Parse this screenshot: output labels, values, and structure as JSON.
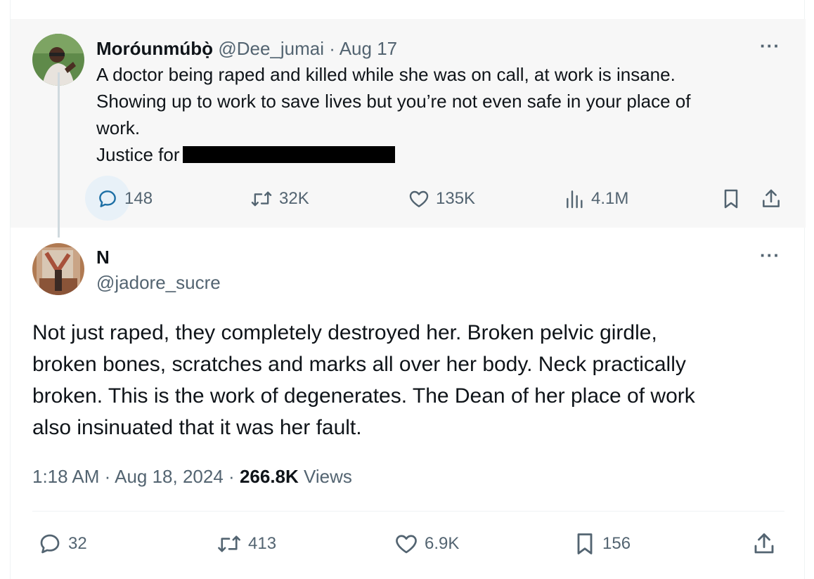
{
  "parent_tweet": {
    "display_name": "Moróunmúbọ̀",
    "handle": "@Dee_jumai",
    "separator": "·",
    "date": "Aug 17",
    "more_icon": "more-horizontal-icon",
    "lines": [
      "A doctor being raped and killed while she was on call, at work is insane.",
      "Showing up to work to save lives but you’re not even safe in your place of",
      "work.",
      "Justice for"
    ],
    "stats": {
      "replies": "148",
      "reposts": "32K",
      "likes": "135K",
      "views": "4.1M"
    }
  },
  "main_tweet": {
    "display_name": "N",
    "handle": "@jadore_sucre",
    "lines": [
      "Not just raped, they completely destroyed her. Broken pelvic girdle,",
      "broken bones, scratches and marks all over her body. Neck practically",
      "broken. This is the work of degenerates. The Dean of her place of work",
      "also insinuated that it was her fault."
    ],
    "time": "1:18 AM",
    "sep1": "·",
    "date": "Aug 18, 2024",
    "sep2": "·",
    "views_count": "266.8K",
    "views_label": "Views",
    "stats": {
      "replies": "32",
      "reposts": "413",
      "likes": "6.9K",
      "bookmarks": "156"
    }
  },
  "colors": {
    "text": "#0f1419",
    "muted": "#536471",
    "parent_bg": "#f7f7f7",
    "thread_line": "#cfd9de",
    "reply_highlight": "#e8f1f8"
  }
}
